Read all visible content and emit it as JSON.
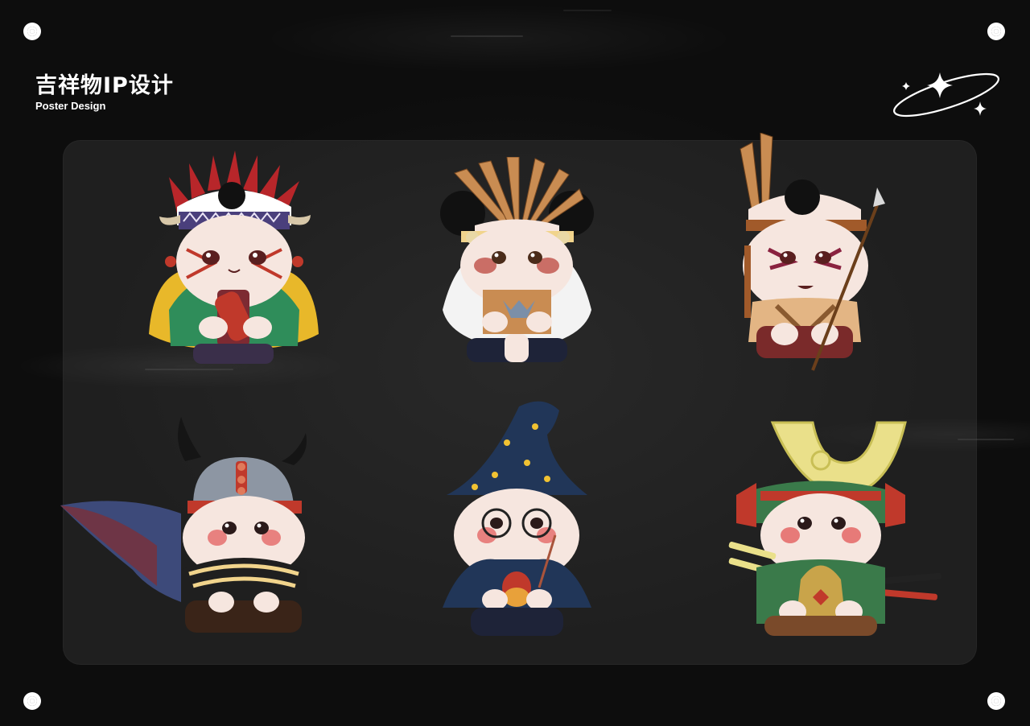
{
  "header": {
    "title": "吉祥物IP设计",
    "subtitle": "Poster Design"
  },
  "logo": {
    "icon": "sparkle-orbit-icon"
  },
  "rivets": {
    "icon": "rivet-icon"
  },
  "colors": {
    "background": "#121212",
    "panel": "#3a3a3a",
    "accent_red": "#c0392b",
    "skin": "#f6e6df"
  },
  "mascots": [
    {
      "name": "tribal-drummer",
      "row": 1,
      "col": 1
    },
    {
      "name": "feather-headdress-chief",
      "row": 1,
      "col": 2
    },
    {
      "name": "spear-warrior",
      "row": 1,
      "col": 3
    },
    {
      "name": "viking",
      "row": 2,
      "col": 1
    },
    {
      "name": "wizard",
      "row": 2,
      "col": 2
    },
    {
      "name": "samurai",
      "row": 2,
      "col": 3
    }
  ]
}
